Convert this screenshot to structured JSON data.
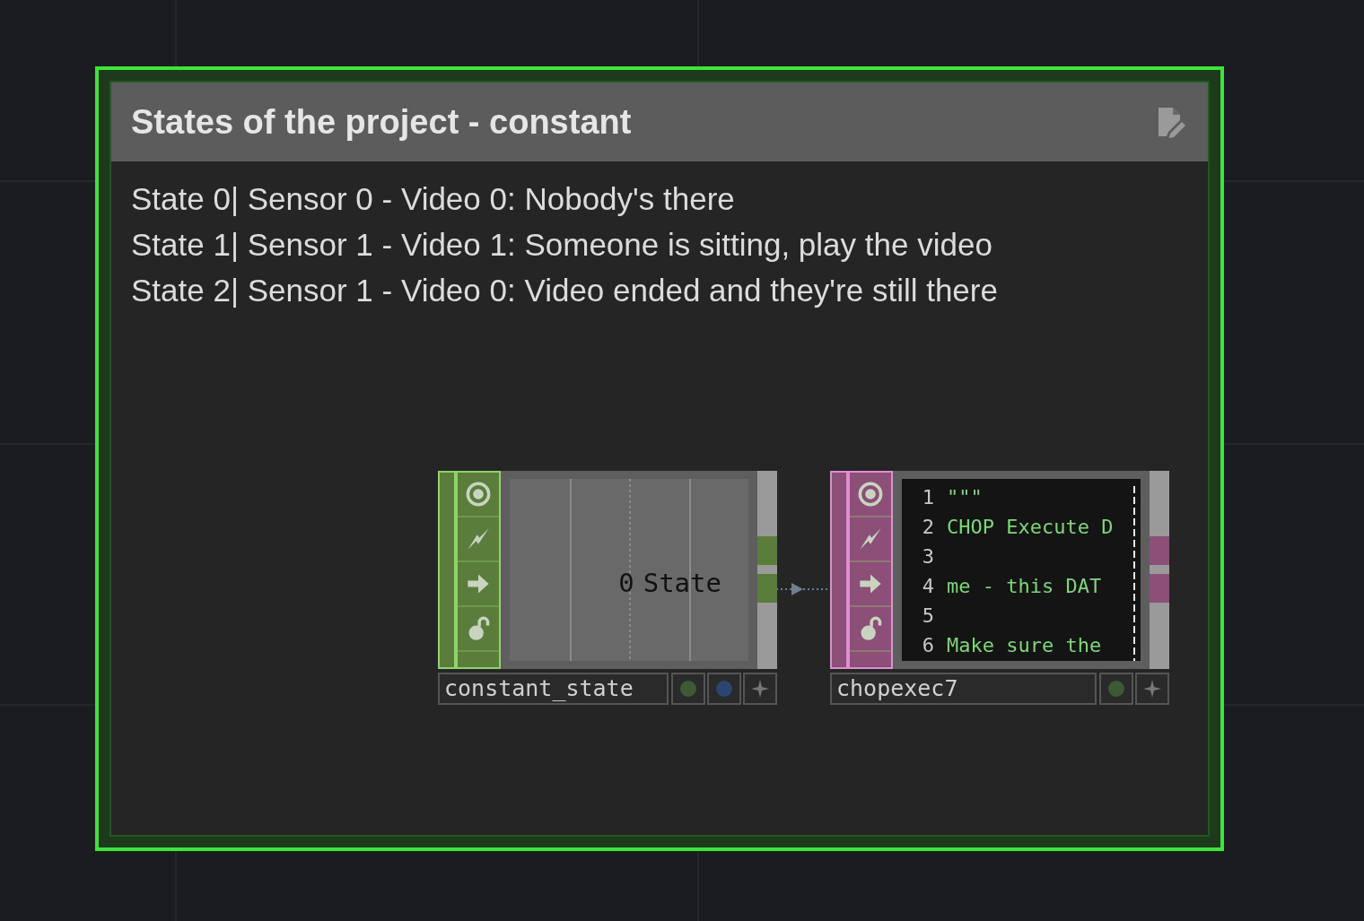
{
  "annotation": {
    "title": "States of the project - constant",
    "lines": [
      "State 0| Sensor 0 - Video 0: Nobody's there",
      "State 1| Sensor 1 - Video 1: Someone is sitting, play the video",
      "State 2| Sensor 1 - Video 0: Video ended and they're still there"
    ]
  },
  "nodes": [
    {
      "kind": "chop",
      "name": "constant_state",
      "value": "0",
      "label": "State",
      "color": "#5a7d3c",
      "footer": [
        {
          "kind": "dot",
          "color": "#3d5a35"
        },
        {
          "kind": "dot",
          "color": "#2c4470"
        },
        {
          "kind": "star"
        }
      ]
    },
    {
      "kind": "dat",
      "name": "chopexec7",
      "color": "#8c4f78",
      "code": [
        {
          "num": "1",
          "text": "\"\"\""
        },
        {
          "num": "2",
          "text": "CHOP Execute D"
        },
        {
          "num": "3"
        },
        {
          "num": "4",
          "text": "me - this DAT"
        },
        {
          "num": "5"
        },
        {
          "num": "6",
          "text": "Make sure the"
        }
      ],
      "footer": [
        {
          "kind": "dot",
          "color": "#3d5a35"
        },
        {
          "kind": "star"
        }
      ]
    }
  ]
}
